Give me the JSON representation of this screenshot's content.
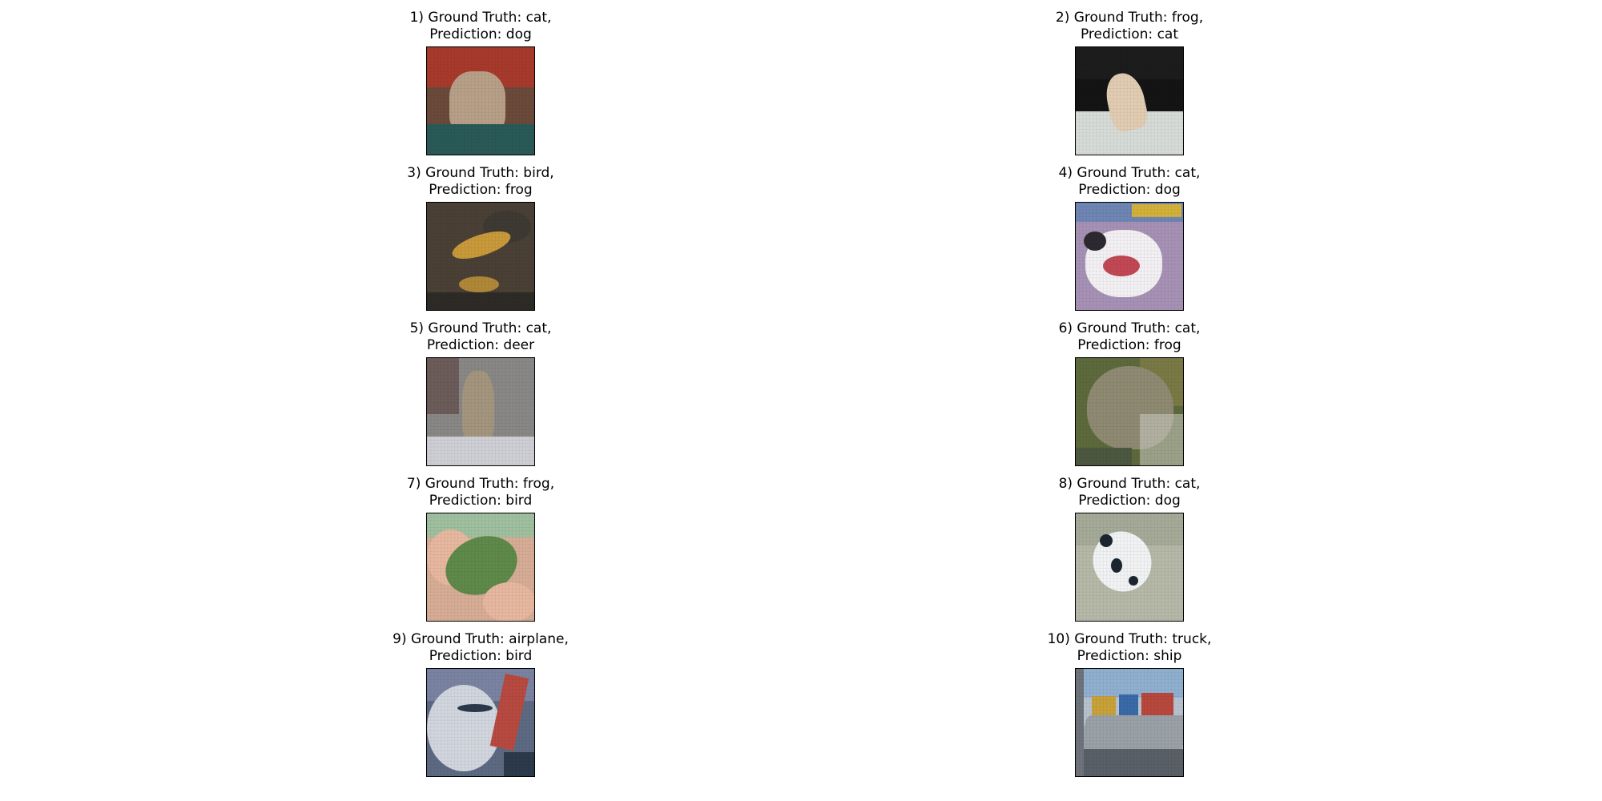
{
  "figure": {
    "panels": [
      {
        "index": 1,
        "line1": "1) Ground Truth: cat,",
        "line2": "Prediction: dog",
        "colors": {
          "bg": "#6b4a3a",
          "top": "#a83a2c",
          "main": "#b8a088",
          "floor": "#2a5a58"
        }
      },
      {
        "index": 2,
        "line1": "2) Ground Truth: frog,",
        "line2": "Prediction: cat",
        "colors": {
          "bg": "#141414",
          "top": "#1c1c1c",
          "main": "#e2cdb3",
          "floor": "#d8dcd8"
        }
      },
      {
        "index": 3,
        "line1": "3) Ground Truth: bird,",
        "line2": "Prediction: frog",
        "colors": {
          "bg": "#4a4036",
          "top": "#3e3a33",
          "main": "#c99a3a",
          "floor": "#2e2b27"
        }
      },
      {
        "index": 4,
        "line1": "4) Ground Truth: cat,",
        "line2": "Prediction: dog",
        "colors": {
          "bg": "#a792b6",
          "top": "#6f86b4",
          "main": "#f3f1f3",
          "floor": "#c24854"
        }
      },
      {
        "index": 5,
        "line1": "5) Ground Truth: cat,",
        "line2": "Prediction: deer",
        "colors": {
          "bg": "#8a8886",
          "top": "#6c5c5a",
          "main": "#a4967e",
          "floor": "#cfd0d6"
        }
      },
      {
        "index": 6,
        "line1": "6) Ground Truth: cat,",
        "line2": "Prediction: frog",
        "colors": {
          "bg": "#5d6a3c",
          "top": "#7a7a46",
          "main": "#8f8a72",
          "floor": "#4c5840"
        }
      },
      {
        "index": 7,
        "line1": "7) Ground Truth: frog,",
        "line2": "Prediction: bird",
        "colors": {
          "bg": "#d7ad96",
          "top": "#a0c0a0",
          "main": "#5f8a4a",
          "floor": "#e8b8a0"
        }
      },
      {
        "index": 8,
        "line1": "8) Ground Truth: cat,",
        "line2": "Prediction: dog",
        "colors": {
          "bg": "#b6b9a8",
          "top": "#a6aa98",
          "main": "#f2f3f4",
          "floor": "#1c2630"
        }
      },
      {
        "index": 9,
        "line1": "9) Ground Truth: airplane,",
        "line2": "Prediction: bird",
        "colors": {
          "bg": "#5d6a82",
          "top": "#7a84a2",
          "main": "#d2d6de",
          "floor": "#2c3a4c"
        }
      },
      {
        "index": 10,
        "line1": "10) Ground Truth: truck,",
        "line2": "Prediction: ship",
        "colors": {
          "bg": "#b7c3cf",
          "top": "#8fb0d0",
          "main": "#9aa1a8",
          "floor": "#5a6068"
        }
      }
    ]
  }
}
